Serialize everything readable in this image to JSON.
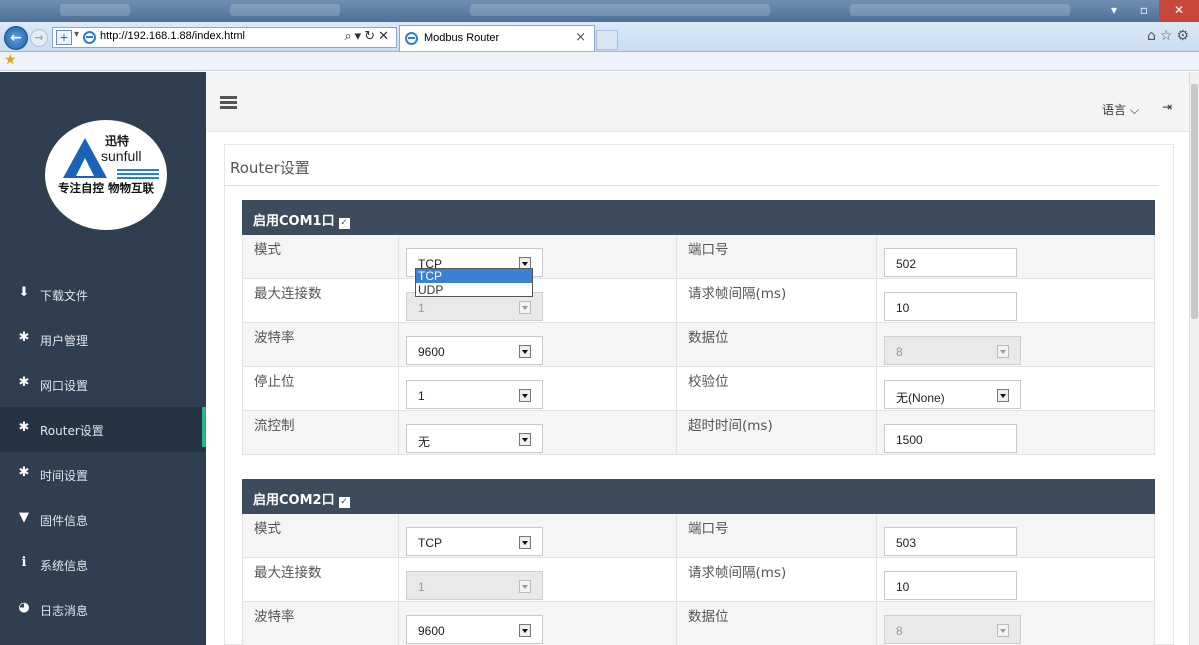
{
  "browser": {
    "url": "http://192.168.1.88/index.html",
    "tab_title": "Modbus Router"
  },
  "sidebar": {
    "logo": {
      "top_text": "迅特",
      "brand": "sunfull",
      "slogan": "专注自控 物物互联"
    },
    "items": [
      {
        "label": "下载文件",
        "icon": "download-icon"
      },
      {
        "label": "用户管理",
        "icon": "gear-icon"
      },
      {
        "label": "网口设置",
        "icon": "gear-icon"
      },
      {
        "label": "Router设置",
        "icon": "gear-icon",
        "active": true
      },
      {
        "label": "时间设置",
        "icon": "gear-icon"
      },
      {
        "label": "固件信息",
        "icon": "filter-icon"
      },
      {
        "label": "系统信息",
        "icon": "info-icon"
      },
      {
        "label": "日志消息",
        "icon": "dashboard-icon"
      }
    ],
    "accent_color": "#28b38a"
  },
  "header": {
    "language": "语言",
    "lang_caret": "⌵",
    "logout_icon": "⇥"
  },
  "page": {
    "title": "Router设置"
  },
  "com1": {
    "title": "启用COM1口",
    "checked": true,
    "mode_label": "模式",
    "mode_value": "TCP",
    "mode_options": [
      "TCP",
      "UDP"
    ],
    "port_label": "端口号",
    "port_value": "502",
    "maxconn_label": "最大连接数",
    "maxconn_value": "1",
    "interval_label": "请求帧间隔(ms)",
    "interval_value": "10",
    "baud_label": "波特率",
    "baud_value": "9600",
    "databits_label": "数据位",
    "databits_value": "8",
    "stopbits_label": "停止位",
    "stopbits_value": "1",
    "parity_label": "校验位",
    "parity_value": "无(None)",
    "flow_label": "流控制",
    "flow_value": "无",
    "timeout_label": "超时时间(ms)",
    "timeout_value": "1500"
  },
  "com2": {
    "title": "启用COM2口",
    "checked": true,
    "mode_label": "模式",
    "mode_value": "TCP",
    "port_label": "端口号",
    "port_value": "503",
    "maxconn_label": "最大连接数",
    "maxconn_value": "1",
    "interval_label": "请求帧间隔(ms)",
    "interval_value": "10",
    "baud_label": "波特率",
    "baud_value": "9600",
    "databits_label": "数据位",
    "databits_value": "8"
  }
}
